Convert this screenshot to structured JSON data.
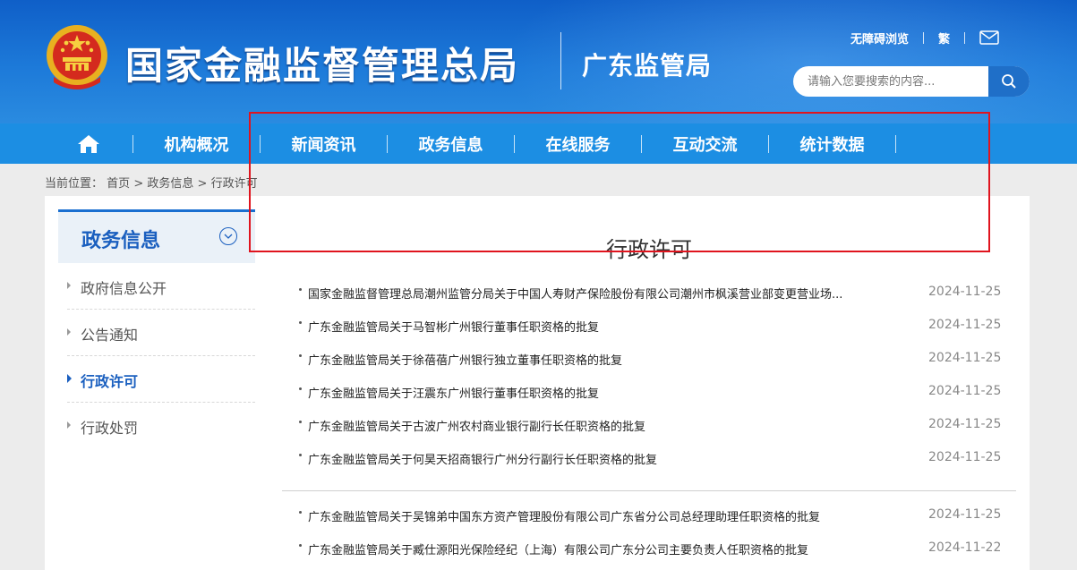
{
  "header": {
    "site_title": "国家金融监督管理总局",
    "sub_title": "广东监管局",
    "links": {
      "accessibility": "无障碍浏览",
      "traditional": "繁"
    },
    "search_placeholder": "请输入您要搜索的内容...",
    "icons": {
      "emblem": "national-emblem-icon",
      "mail": "mail-icon",
      "search": "search-icon"
    }
  },
  "nav": {
    "home_icon": "home-icon",
    "items": [
      "机构概况",
      "新闻资讯",
      "政务信息",
      "在线服务",
      "互动交流",
      "统计数据"
    ]
  },
  "breadcrumb": {
    "label": "当前位置：",
    "home": "首页",
    "sep": ">",
    "section": "政务信息",
    "current": "行政许可"
  },
  "sidebar": {
    "title": "政务信息",
    "toggle_icon": "chevron-down-circle-icon",
    "items": [
      {
        "label": "政府信息公开"
      },
      {
        "label": "公告通知"
      },
      {
        "label": "行政许可"
      },
      {
        "label": "行政处罚"
      }
    ],
    "active": "行政许可"
  },
  "main": {
    "page_title": "行政许可",
    "rows": [
      {
        "title": "国家金融监督管理总局潮州监管分局关于中国人寿财产保险股份有限公司潮州市枫溪营业部变更营业场...",
        "date": "2024-11-25"
      },
      {
        "title": "广东金融监管局关于马智彬广州银行董事任职资格的批复",
        "date": "2024-11-25"
      },
      {
        "title": "广东金融监管局关于徐蓓蓓广州银行独立董事任职资格的批复",
        "date": "2024-11-25"
      },
      {
        "title": "广东金融监管局关于汪震东广州银行董事任职资格的批复",
        "date": "2024-11-25"
      },
      {
        "title": "广东金融监管局关于古波广州农村商业银行副行长任职资格的批复",
        "date": "2024-11-25"
      },
      {
        "title": "广东金融监管局关于何昊天招商银行广州分行副行长任职资格的批复",
        "date": "2024-11-25"
      },
      {
        "title": "广东金融监管局关于吴锦弟中国东方资产管理股份有限公司广东省分公司总经理助理任职资格的批复",
        "date": "2024-11-25"
      },
      {
        "title": "广东金融监管局关于臧仕源阳光保险经纪（上海）有限公司广东分公司主要负责人任职资格的批复",
        "date": "2024-11-22"
      }
    ]
  },
  "colors": {
    "header_blue": "#1d7ad9",
    "nav_blue": "#1c8ee3",
    "accent": "#1a5fbf",
    "highlight_red": "#e0141e"
  }
}
